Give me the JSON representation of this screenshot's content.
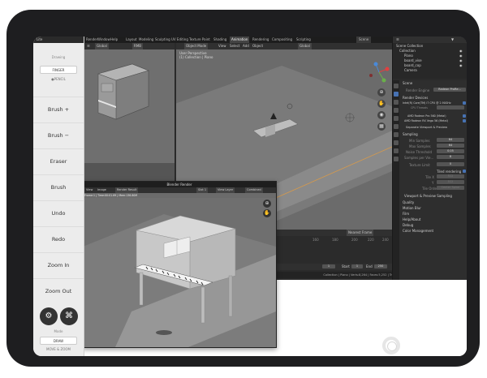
{
  "sidebar": {
    "title": "Lite",
    "drawing_label": "Drawing",
    "drawing_options": [
      "FINGER",
      "●PENCIL"
    ],
    "buttons": [
      "Brush +",
      "Brush −",
      "Eraser",
      "Brush",
      "Undo",
      "Redo",
      "Zoom In",
      "Zoom Out"
    ],
    "mode_label": "Mode",
    "mode_options": [
      "DRAW",
      "MOVE & ZOOM"
    ]
  },
  "topbar": {
    "menus": [
      "Render",
      "Window",
      "Help"
    ],
    "workspaces": [
      "Layout",
      "Modeling",
      "Sculpting",
      "UV Editing",
      "Texture Paint",
      "Shading",
      "Animation",
      "Rendering",
      "Compositing",
      "Scripting"
    ],
    "active_workspace": "Animation",
    "scene": "Scene",
    "view_layer": "View Layer"
  },
  "viewport": {
    "mode": "Object Mode",
    "menus": [
      "View",
      "Select",
      "Add",
      "Object"
    ],
    "transform": "Global",
    "label_line1": "User Perspective",
    "label_line2": "(1) Collection | Piano"
  },
  "left_header": {
    "transform": "Global",
    "shading": "RMB"
  },
  "outliner": {
    "items": [
      "Scene Collection",
      "Collection",
      "Piano",
      "board_vise",
      "board_cop",
      "Camera"
    ]
  },
  "properties": {
    "breadcrumb": "Scene",
    "render_engine_label": "Render Engine",
    "render_engine_value": "Radeon ProRe...",
    "render_devices_header": "Render Devices",
    "devices": [
      "Intel(R) Core(TM) i7 CPU @ 2.90GHz",
      "CPU Threads",
      "AMD Radeon Pro 560 (Metal)",
      "AMD Radeon RX Vega 56 (Metal)"
    ],
    "separate_viewport": "Separate Viewport & Preview",
    "sampling_header": "Sampling",
    "sampling_rows": [
      {
        "label": "Min Samples",
        "value": "64"
      },
      {
        "label": "Max Samples",
        "value": "64"
      },
      {
        "label": "Noise Threshold",
        "value": "0.05"
      },
      {
        "label": "Samples per Vie...",
        "value": "8"
      },
      {
        "label": "Texture Limit",
        "value": "0"
      }
    ],
    "tiled_rendering": "Tiled rendering",
    "tiled_rows": [
      {
        "label": "Tile X",
        "value": "512"
      },
      {
        "label": "Y",
        "value": "512"
      },
      {
        "label": "Tile Order",
        "value": "Center Spiral"
      }
    ],
    "collapsed_sections": [
      "Viewport & Preview Sampling",
      "Quality",
      "Motion Blur",
      "Film",
      "Help/About",
      "Debug",
      "Color Management"
    ]
  },
  "timeline": {
    "interpolation": "Nearest Frame",
    "ticks": [
      "160",
      "180",
      "200",
      "220",
      "240"
    ],
    "start_label": "Start",
    "start_value": "1",
    "end_label": "End",
    "end_value": "250",
    "current_frame": "1"
  },
  "statusbar": {
    "text": "Collection | Piano | Verts:8,264 | Faces:5,252 | Tris:11,964 | Objects:1/21 | Mem: 84.3 MiB | v2.92.0"
  },
  "render_window": {
    "title": "Blender Render",
    "menus": [
      "View",
      "Image"
    ],
    "image_name": "Render Result",
    "slot": "Slot 1",
    "view_layer": "View Layer",
    "pass": "Combined",
    "info": "Frame:1 | Time:00:01.69 | Mem:136.80M"
  }
}
